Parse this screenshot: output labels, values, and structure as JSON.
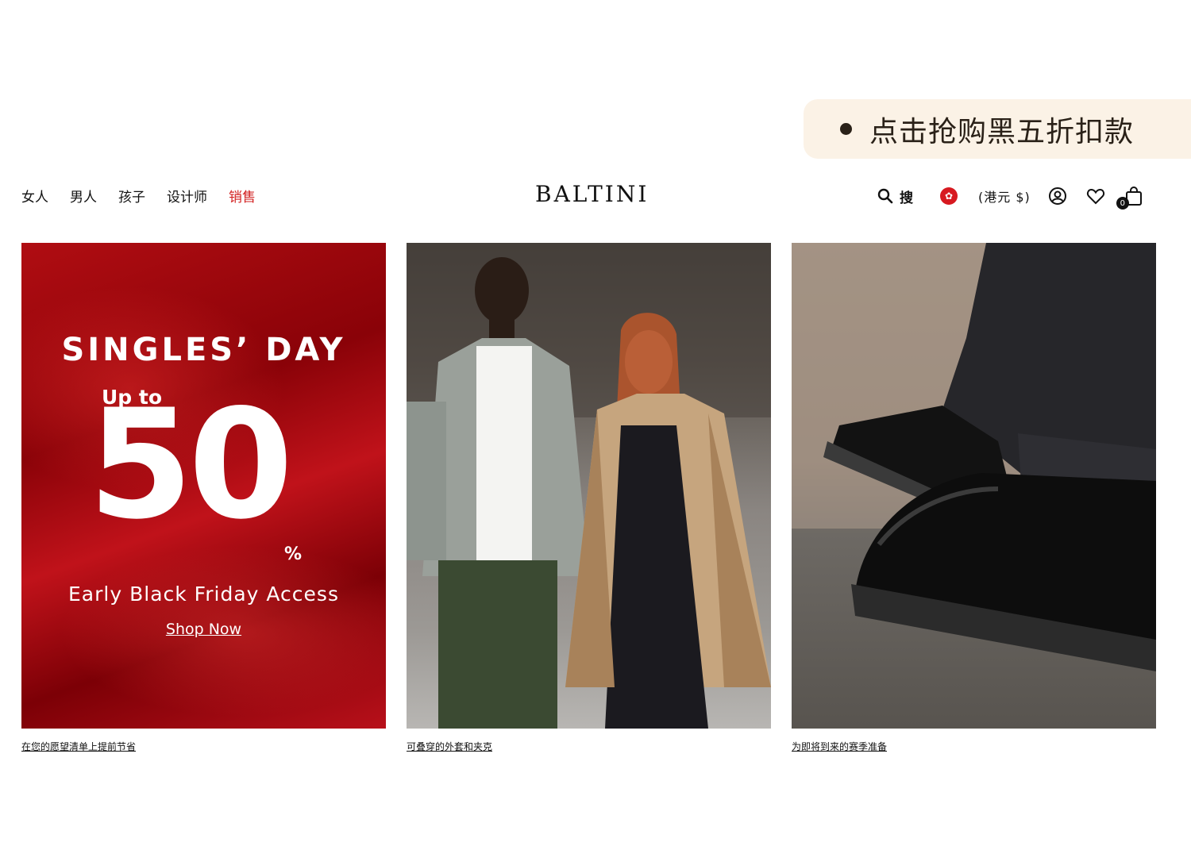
{
  "callout": {
    "text": "点击抢购黑五折扣款"
  },
  "nav": {
    "items": [
      "女人",
      "男人",
      "孩子",
      "设计师",
      "销售"
    ]
  },
  "brand": {
    "logo": "BALTINI"
  },
  "tools": {
    "search_label": "搜",
    "currency": "(港元 $)",
    "bag_count": "0",
    "icons": [
      "search-icon",
      "hong-kong-flag-icon",
      "account-icon",
      "heart-icon",
      "bag-icon"
    ]
  },
  "cards": [
    {
      "caption": "在您的愿望清单上提前节省",
      "banner": {
        "title": "SINGLES’ DAY",
        "upto": "Up to",
        "big": "50",
        "pct": "%",
        "sub": "Early Black Friday Access",
        "cta": "Shop Now"
      }
    },
    {
      "caption": "可叠穿的外套和夹克"
    },
    {
      "caption": "为即将到来的赛季准备"
    }
  ],
  "colors": {
    "sale": "#d21f1f",
    "callout_bg": "#fbf2e6",
    "banner_red": "#b00d12"
  }
}
